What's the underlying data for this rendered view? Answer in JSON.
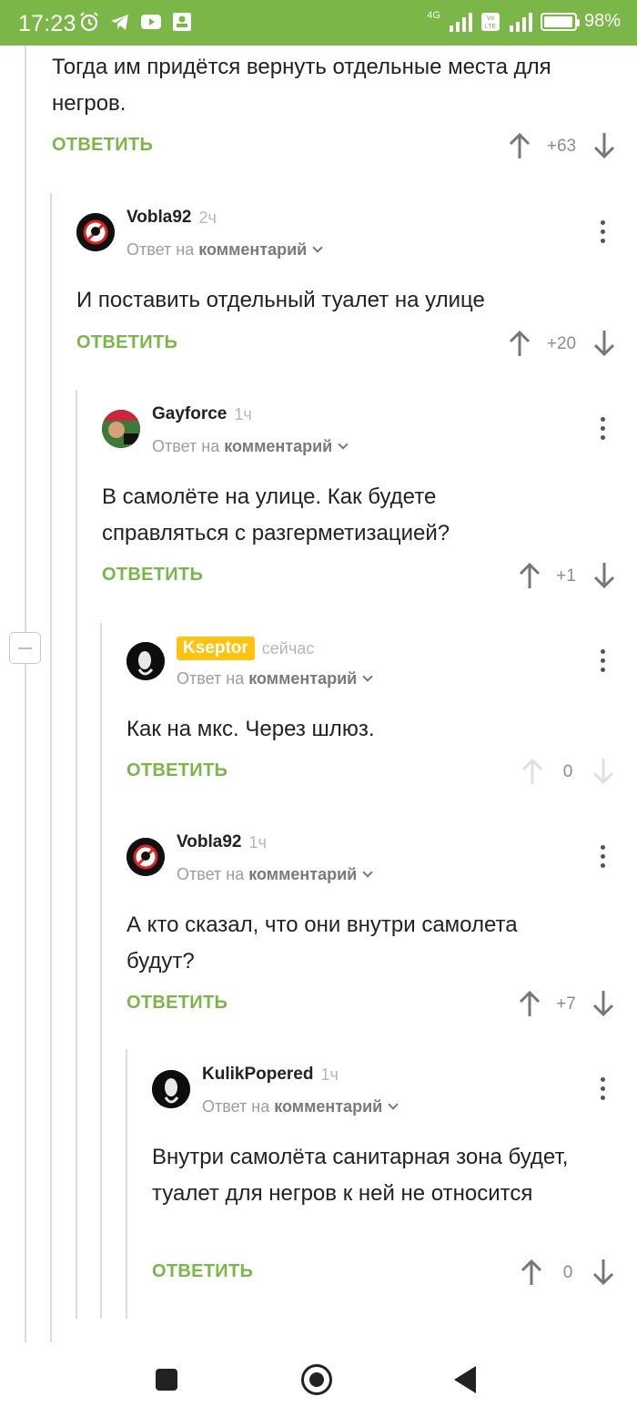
{
  "status_bar": {
    "time": "17:23",
    "network": "4G",
    "battery": "98%",
    "battery_level": 0.98
  },
  "comments": [
    {
      "text": "Тогда им придётся вернуть отдельные места для негров.",
      "reply_label": "ОТВЕТИТЬ",
      "score": "+63"
    },
    {
      "username": "Vobla92",
      "time": "2ч",
      "reply_prefix": "Ответ на",
      "reply_target": "комментарий",
      "text": "И поставить отдельный туалет на улице",
      "reply_label": "ОТВЕТИТЬ",
      "score": "+20"
    },
    {
      "username": "Gayforce",
      "time": "1ч",
      "reply_prefix": "Ответ на",
      "reply_target": "комментарий",
      "text": "В самолёте на улице. Как будете справляться с разгерметизацией?",
      "reply_label": "ОТВЕТИТЬ",
      "score": "+1"
    },
    {
      "username": "Kseptor",
      "time": "сейчас",
      "reply_prefix": "Ответ на",
      "reply_target": "комментарий",
      "text": "Как на мкс. Через шлюз.",
      "reply_label": "ОТВЕТИТЬ",
      "score": "0"
    },
    {
      "username": "Vobla92",
      "time": "1ч",
      "reply_prefix": "Ответ на",
      "reply_target": "комментарий",
      "text": "А кто сказал, что они внутри самолета будут?",
      "reply_label": "ОТВЕТИТЬ",
      "score": "+7"
    },
    {
      "username": "KulikPopered",
      "time": "1ч",
      "reply_prefix": "Ответ на",
      "reply_target": "комментарий",
      "text": "Внутри самолёта санитарная зона будет, туалет для негров к ней не относится",
      "reply_label": "ОТВЕТИТЬ",
      "score": "0"
    }
  ],
  "colors": {
    "accent": "#7ab648",
    "badge": "#ffc20e"
  }
}
